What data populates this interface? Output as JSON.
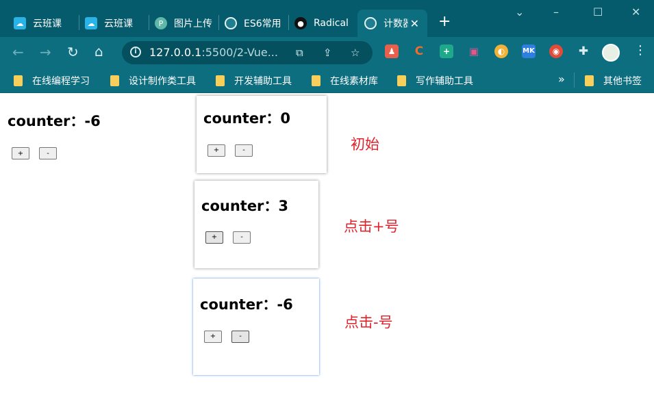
{
  "browser": {
    "tabs": [
      {
        "title": "云班课",
        "icon": "cloud-class-icon"
      },
      {
        "title": "云班课",
        "icon": "cloud-class-icon"
      },
      {
        "title": "图片上传",
        "icon": "picgo-icon"
      },
      {
        "title": "ES6常用",
        "icon": "globe-icon"
      },
      {
        "title": "Radical",
        "icon": "github-icon"
      },
      {
        "title": "计数器",
        "icon": "globe-icon",
        "close": "✕"
      }
    ],
    "new_tab": "+",
    "address": {
      "host": "127.0.0.1",
      "rest": ":5500/2-Vue..."
    },
    "bookmarks": [
      "在线编程学习",
      "设计制作类工具",
      "开发辅助工具",
      "在线素材库",
      "写作辅助工具"
    ],
    "more_bookmarks": "»",
    "other_bookmarks": "其他书签"
  },
  "main_app": {
    "title": "counter：-6",
    "plus_label": "+",
    "minus_label": "-"
  },
  "screenshots": [
    {
      "title": "counter：0",
      "plus_label": "+",
      "minus_label": "-",
      "annotation": "初始"
    },
    {
      "title": "counter：3",
      "plus_label": "+",
      "minus_label": "-",
      "annotation": "点击+号"
    },
    {
      "title": "counter：-6",
      "plus_label": "+",
      "minus_label": "-",
      "annotation": "点击-号"
    }
  ],
  "colors": {
    "chrome_dark": "#055a6b",
    "chrome_toolbar": "#0d6e80",
    "annotation_red": "#e0222b"
  }
}
